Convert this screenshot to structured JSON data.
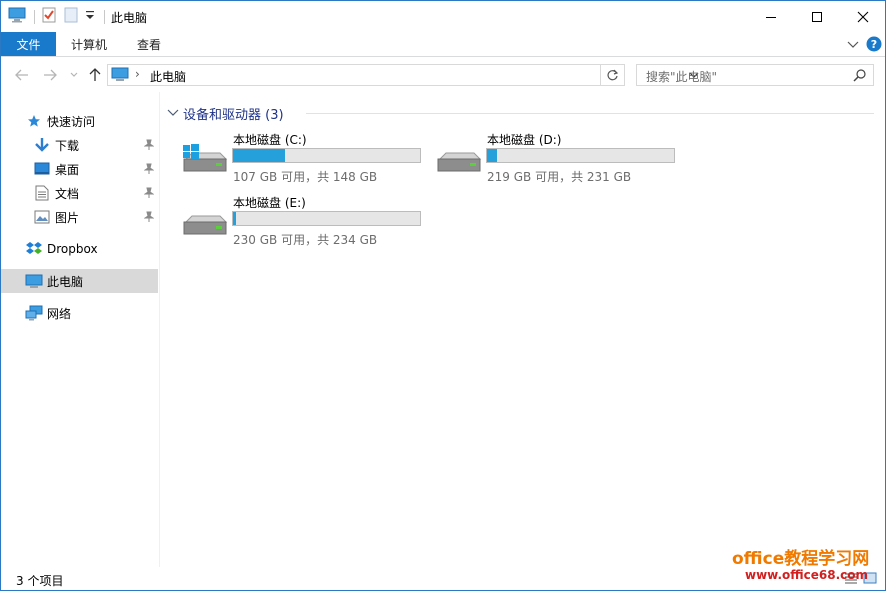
{
  "window": {
    "title": "此电脑"
  },
  "ribbon": {
    "tabs": [
      {
        "label": "文件",
        "active": true
      },
      {
        "label": "计算机"
      },
      {
        "label": "查看"
      }
    ]
  },
  "address": {
    "path": "此电脑"
  },
  "search": {
    "placeholder": "搜索\"此电脑\""
  },
  "sidebar": {
    "quick_access": "快速访问",
    "quick_items": [
      {
        "label": "下载",
        "icon": "download-arrow-icon"
      },
      {
        "label": "桌面",
        "icon": "desktop-icon"
      },
      {
        "label": "文档",
        "icon": "document-icon"
      },
      {
        "label": "图片",
        "icon": "picture-icon"
      }
    ],
    "dropbox": "Dropbox",
    "this_pc": "此电脑",
    "network": "网络"
  },
  "content": {
    "group_title": "设备和驱动器 (3)",
    "drives": [
      {
        "name": "本地磁盘 (C:)",
        "info": "107 GB 可用，共 148 GB",
        "used_fraction": 0.277,
        "system": true
      },
      {
        "name": "本地磁盘 (D:)",
        "info": "219 GB 可用，共 231 GB",
        "used_fraction": 0.052,
        "system": false
      },
      {
        "name": "本地磁盘 (E:)",
        "info": "230 GB 可用，共 234 GB",
        "used_fraction": 0.017,
        "system": false
      }
    ]
  },
  "status": {
    "count": "3 个项目"
  },
  "watermark": {
    "line1": "office教程学习网",
    "line2": "www.office68.com"
  },
  "colors": {
    "accent": "#1979ca",
    "bar_fill": "#26a0da",
    "group_title": "#1e3287"
  }
}
